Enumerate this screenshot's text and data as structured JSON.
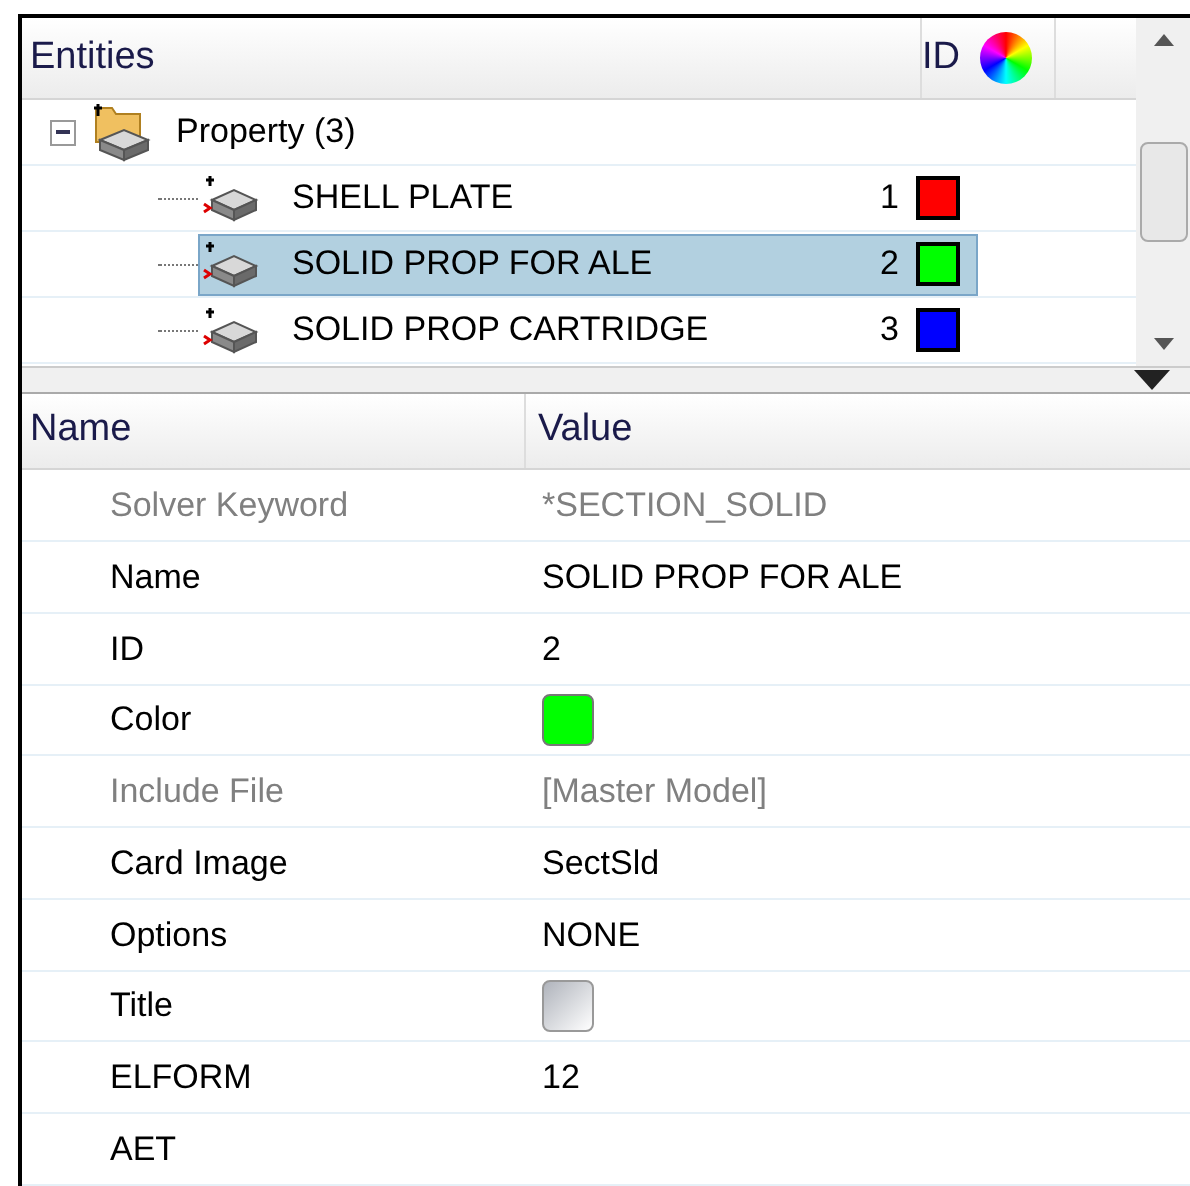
{
  "entities": {
    "columns": [
      "Entities",
      "ID"
    ],
    "tree": [
      {
        "label": "Property (3)",
        "expanded": true,
        "children": [
          {
            "label": "SHELL PLATE",
            "id": "1",
            "color": "#ff0000",
            "selected": false
          },
          {
            "label": "SOLID PROP FOR ALE",
            "id": "2",
            "color": "#00ff00",
            "selected": true
          },
          {
            "label": "SOLID PROP CARTRIDGE",
            "id": "3",
            "color": "#0000ff",
            "selected": false
          }
        ]
      }
    ]
  },
  "properties": {
    "columns": [
      "Name",
      "Value"
    ],
    "rows": [
      {
        "name": "Solver Keyword",
        "kind": "text",
        "value": "*SECTION_SOLID",
        "disabled": true
      },
      {
        "name": "Name",
        "kind": "text",
        "value": "SOLID PROP FOR ALE",
        "disabled": false
      },
      {
        "name": "ID",
        "kind": "text",
        "value": "2",
        "disabled": false
      },
      {
        "name": "Color",
        "kind": "color",
        "color": "#00ff00",
        "disabled": false
      },
      {
        "name": "Include File",
        "kind": "text",
        "value": "[Master Model]",
        "disabled": true
      },
      {
        "name": "Card Image",
        "kind": "text",
        "value": "SectSld",
        "disabled": false
      },
      {
        "name": "Options",
        "kind": "text",
        "value": "NONE",
        "disabled": false
      },
      {
        "name": "Title",
        "kind": "checkbox",
        "checked": false,
        "disabled": false
      },
      {
        "name": "ELFORM",
        "kind": "text",
        "value": "12",
        "disabled": false
      },
      {
        "name": "AET",
        "kind": "text",
        "value": "",
        "disabled": false
      }
    ]
  }
}
